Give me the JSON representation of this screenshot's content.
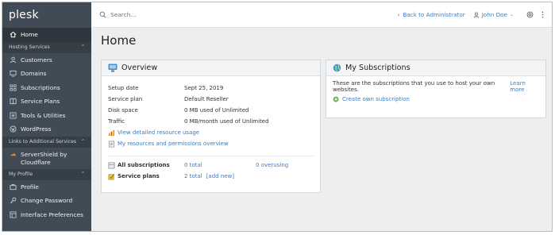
{
  "sidebar": {
    "logo": "plesk",
    "home": "Home",
    "sections": {
      "hosting": "Hosting Services",
      "links": "Links to Additional Services",
      "profile": "My Profile"
    },
    "hosting_items": [
      "Customers",
      "Domains",
      "Subscriptions",
      "Service Plans",
      "Tools & Utilities",
      "WordPress"
    ],
    "links_items": [
      "ServerShield by Cloudflare"
    ],
    "profile_items": [
      "Profile",
      "Change Password",
      "Interface Preferences"
    ]
  },
  "topbar": {
    "search_placeholder": "Search...",
    "back_link": "Back to Administrator",
    "user": "John Doe"
  },
  "main": {
    "title": "Home",
    "overview": {
      "title": "Overview",
      "rows": [
        {
          "label": "Setup date",
          "value": "Sept 25, 2019"
        },
        {
          "label": "Service plan",
          "value": "Default Reseller"
        },
        {
          "label": "Disk space",
          "value": "0 MB used of Unlimited"
        },
        {
          "label": "Traffic",
          "value": "0 MB/month used of Unlimited"
        }
      ],
      "link_usage": "View detailed resource usage",
      "link_perms": "My resources and permissions overview",
      "all_subs_label": "All subscriptions",
      "all_subs_total": "0 total",
      "all_subs_overusing": "0 overusing",
      "plans_label": "Service plans",
      "plans_total": "2 total",
      "plans_add": "[add new]"
    },
    "subscriptions": {
      "title": "My Subscriptions",
      "text": "These are the subscriptions that you use to host your own websites.",
      "learn_more": "Learn more",
      "create": "Create own subscription"
    }
  },
  "colors": {
    "sidebar_bg": "#414b55",
    "sidebar_active": "#2e363e",
    "link": "#3b7dc3"
  }
}
